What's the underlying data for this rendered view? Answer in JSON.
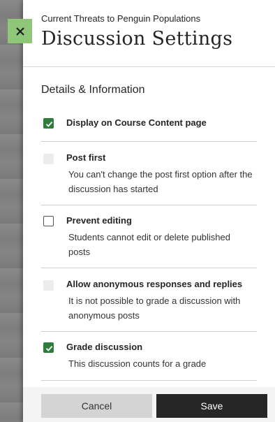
{
  "header": {
    "course_title": "Current Threats to Penguin Populations",
    "page_title": "Discussion Settings",
    "close_icon": "close-icon",
    "close_color": "#8fc779"
  },
  "section": {
    "heading": "Details & Information"
  },
  "options": [
    {
      "label": "Display on Course Content page",
      "description": "",
      "state": "checked"
    },
    {
      "label": "Post first",
      "description": "You can't change the post first option after the discussion has started",
      "state": "disabled"
    },
    {
      "label": "Prevent editing",
      "description": "Students cannot edit or delete published posts",
      "state": "unchecked"
    },
    {
      "label": "Allow anonymous responses and replies",
      "description": "It is not possible to grade a discussion with anonymous posts",
      "state": "disabled"
    },
    {
      "label": "Grade discussion",
      "description": "This discussion counts for a grade",
      "state": "checked"
    }
  ],
  "footer": {
    "cancel_label": "Cancel",
    "save_label": "Save"
  },
  "colors": {
    "check_green": "#2e7d3a",
    "primary_dark": "#262626"
  }
}
